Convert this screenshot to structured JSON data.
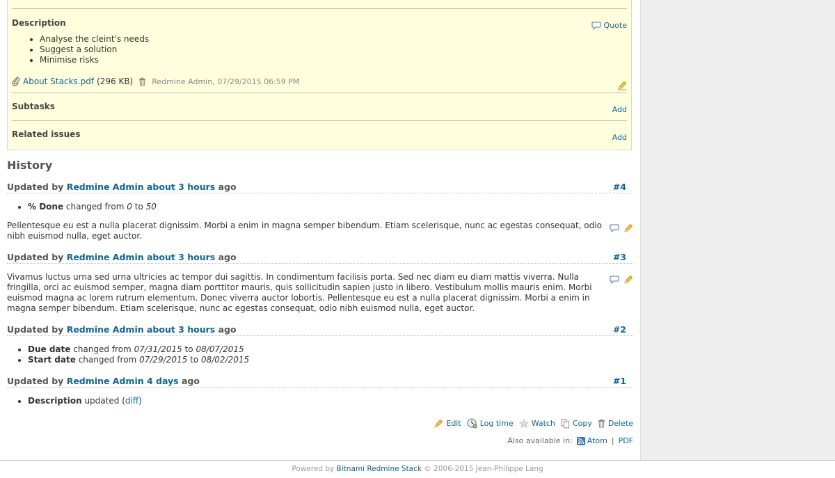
{
  "issue": {
    "description_label": "Description",
    "quote_label": "Quote",
    "description_items": [
      "Analyse the cleint's needs",
      "Suggest a solution",
      "Minimise risks"
    ],
    "attachment": {
      "filename": "About Stacks.pdf",
      "size": "(296 KB)",
      "meta": "Redmine Admin, 07/29/2015 06:59 PM"
    },
    "subtasks_label": "Subtasks",
    "related_label": "Related issues",
    "add_label": "Add"
  },
  "history": {
    "title": "History",
    "updated_by": "Updated by",
    "ago": "ago",
    "journals": [
      {
        "author": "Redmine Admin",
        "when": "about 3 hours",
        "number": "#4",
        "details": [
          {
            "field": "% Done",
            "verb": "changed from",
            "from": "0",
            "to_word": "to",
            "to": "50"
          }
        ],
        "notes": "Pellentesque eu est a nulla placerat dignissim. Morbi a enim in magna semper bibendum. Etiam scelerisque, nunc ac egestas consequat, odio nibh euismod nulla, eget auctor."
      },
      {
        "author": "Redmine Admin",
        "when": "about 3 hours",
        "number": "#3",
        "notes": "Vivamus luctus urna sed urna ultricies ac tempor dui sagittis. In condimentum facilisis porta. Sed nec diam eu diam mattis viverra. Nulla fringilla, orci ac euismod semper, magna diam porttitor mauris, quis sollicitudin sapien justo in libero. Vestibulum mollis mauris enim. Morbi euismod magna ac lorem rutrum elementum. Donec viverra auctor lobortis. Pellentesque eu est a nulla placerat dignissim. Morbi a enim in magna semper bibendum. Etiam scelerisque, nunc ac egestas consequat, odio nibh euismod nulla, eget auctor."
      },
      {
        "author": "Redmine Admin",
        "when": "about 3 hours",
        "number": "#2",
        "details": [
          {
            "field": "Due date",
            "verb": "changed from",
            "from": "07/31/2015",
            "to_word": "to",
            "to": "08/07/2015"
          },
          {
            "field": "Start date",
            "verb": "changed from",
            "from": "07/29/2015",
            "to_word": "to",
            "to": "08/02/2015"
          }
        ]
      },
      {
        "author": "Redmine Admin",
        "when": "4 days",
        "number": "#1",
        "description_detail": {
          "field": "Description",
          "verb": "updated",
          "open": "(",
          "link": "diff",
          "close": ")"
        }
      }
    ]
  },
  "actions": {
    "edit": "Edit",
    "log_time": "Log time",
    "watch": "Watch",
    "copy": "Copy",
    "delete": "Delete"
  },
  "formats": {
    "label": "Also available in:",
    "atom": "Atom",
    "separator": "|",
    "pdf": "PDF"
  },
  "footer": {
    "powered_by": "Powered by",
    "link": "Bitnami Redmine Stack",
    "copyright": "© 2006-2015 Jean-Philippe Lang"
  }
}
